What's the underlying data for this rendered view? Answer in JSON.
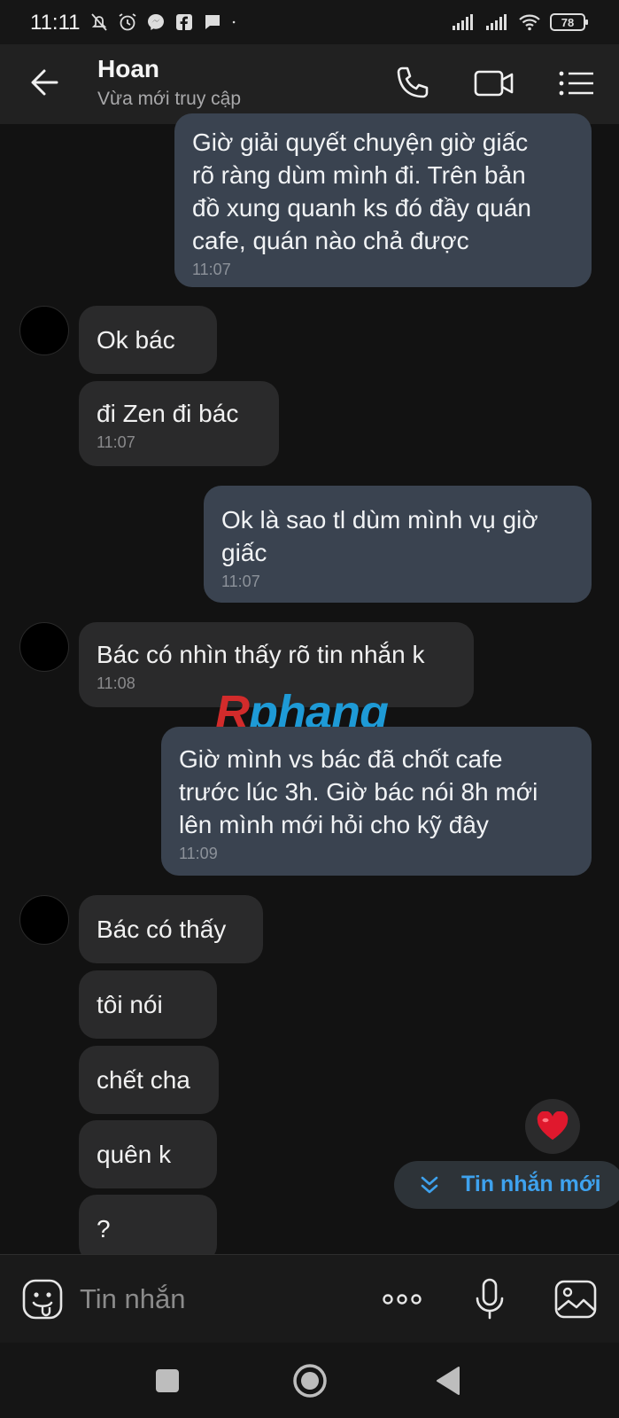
{
  "status_bar": {
    "time": "11:11",
    "battery": "78",
    "left_icons": [
      "muted-bell-icon",
      "alarm-icon",
      "messenger-icon",
      "facebook-icon",
      "chat-icon",
      "dot-icon"
    ],
    "right_icons": [
      "signal-icon",
      "signal-icon",
      "wifi-icon",
      "battery-icon"
    ]
  },
  "header": {
    "name": "Hoan",
    "status": "Vừa mới truy cập",
    "actions": [
      "phone-icon",
      "video-icon",
      "menu-icon"
    ]
  },
  "messages": [
    {
      "dir": "out",
      "text": "Giờ giải quyết chuyện giờ giấc\nrõ ràng dùm mình đi. Trên bản\nđồ xung quanh ks đó đầy quán\ncafe, quán nào chả được",
      "time": "11:07"
    },
    {
      "dir": "in",
      "text": "Ok bác",
      "time": ""
    },
    {
      "dir": "in",
      "text": "đi Zen đi bác",
      "time": "11:07"
    },
    {
      "dir": "out",
      "text": "Ok là sao tl dùm mình vụ giờ\ngiấc",
      "time": "11:07"
    },
    {
      "dir": "in",
      "text": "Bác có nhìn thấy rõ tin nhắn k",
      "time": "11:08"
    },
    {
      "dir": "out",
      "text": "Giờ mình vs bác đã chốt cafe\ntrước lúc 3h. Giờ bác nói 8h mới\nlên mình mới hỏi cho kỹ đây",
      "time": "11:09"
    },
    {
      "dir": "in",
      "text": "Bác có thấy",
      "time": ""
    },
    {
      "dir": "in",
      "text": "tôi nói",
      "time": ""
    },
    {
      "dir": "in",
      "text": "chết cha",
      "time": ""
    },
    {
      "dir": "in",
      "text": "quên k",
      "time": ""
    },
    {
      "dir": "in",
      "text": "?",
      "time": ""
    }
  ],
  "watermark": {
    "first": "R",
    "rest": "phang"
  },
  "reaction": {
    "icon": "heart-icon",
    "color": "#e0182d"
  },
  "new_message": {
    "label": "Tin nhắn mới",
    "icon": "double-chevron-down-icon"
  },
  "composer": {
    "placeholder": "Tin nhắn",
    "icons": [
      "emoji-icon",
      "more-icon",
      "microphone-icon",
      "image-icon"
    ]
  },
  "nav": {
    "icons": [
      "recents-icon",
      "home-icon",
      "back-triangle-icon"
    ]
  },
  "colors": {
    "accent": "#3ea2ee",
    "bubble_out": "#3a4350",
    "bubble_in": "#2a2a2b",
    "background": "#121212"
  }
}
